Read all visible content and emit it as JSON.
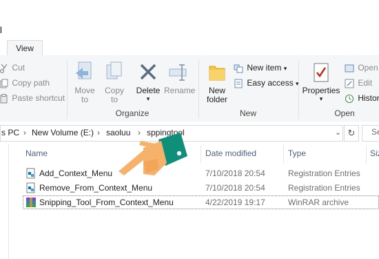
{
  "window": {
    "title_fragment": "l"
  },
  "tabs": [
    {
      "label": "View"
    }
  ],
  "ribbon": {
    "clipboard": {
      "cut": "Cut",
      "copy_path": "Copy path",
      "paste_shortcut": "Paste shortcut"
    },
    "organize": {
      "move_to": "Move",
      "move_to_sub": "to",
      "copy_to": "Copy",
      "copy_to_sub": "to",
      "delete": "Delete",
      "rename": "Rename",
      "group_label": "Organize"
    },
    "new": {
      "new_folder_line1": "New",
      "new_folder_line2": "folder",
      "new_item": "New item",
      "easy_access": "Easy access",
      "group_label": "New"
    },
    "open": {
      "properties": "Properties",
      "open": "Open",
      "edit": "Edit",
      "history": "History",
      "group_label": "Open"
    }
  },
  "address": {
    "crumbs": [
      "s PC",
      "New Volume (E:)",
      "saoluu",
      "sppingtool"
    ],
    "search_placeholder": "Se"
  },
  "columns": {
    "name": "Name",
    "date_modified": "Date modified",
    "type": "Type",
    "size": "Siz"
  },
  "files": [
    {
      "name": "Add_Context_Menu",
      "date": "7/10/2018 20:54",
      "type": "Registration Entries",
      "icon": "registry-file-icon"
    },
    {
      "name": "Remove_From_Context_Menu",
      "date": "7/10/2018 20:54",
      "type": "Registration Entries",
      "icon": "registry-file-icon"
    },
    {
      "name": "Snipping_Tool_From_Context_Menu",
      "date": "4/22/2019 19:17",
      "type": "WinRAR archive",
      "icon": "winrar-archive-icon"
    }
  ],
  "colors": {
    "accent_blue": "#0078d7",
    "folder_yellow": "#f4c542",
    "delete_red": "#c42b1c",
    "pointer_skin": "#f6b26b",
    "pointer_cuff": "#0f8f7a"
  }
}
